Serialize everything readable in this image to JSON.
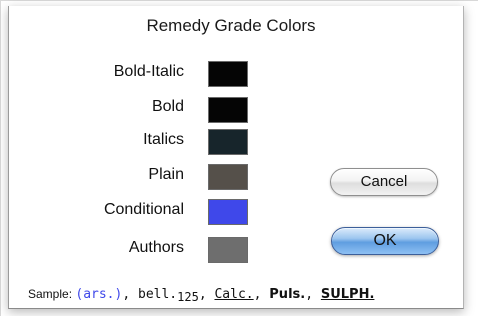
{
  "dialog": {
    "title": "Remedy Grade Colors"
  },
  "grades": [
    {
      "label": "Bold-Italic",
      "color": "#050505"
    },
    {
      "label": "Bold",
      "color": "#050505"
    },
    {
      "label": "Italics",
      "color": "#17252b"
    },
    {
      "label": "Plain",
      "color": "#55504a"
    },
    {
      "label": "Conditional",
      "color": "#3f48ea"
    },
    {
      "label": "Authors",
      "color": "#6e6e6e"
    }
  ],
  "buttons": {
    "cancel_label": "Cancel",
    "ok_label": "OK"
  },
  "sample": {
    "label": "Sample:",
    "conditional": "(ars.)",
    "plain": "bell.",
    "author_number": "125",
    "italic": "Calc.",
    "bold": "Puls.",
    "bold_italic": "SULPH."
  }
}
